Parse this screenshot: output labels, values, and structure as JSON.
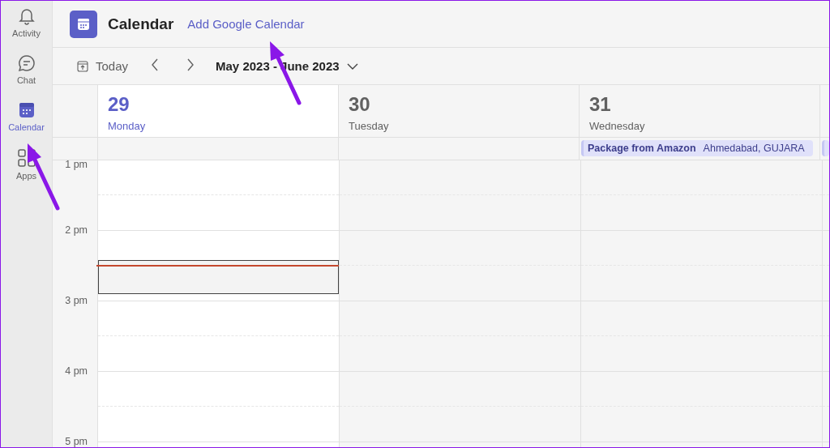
{
  "sidebar": {
    "items": [
      {
        "label": "Activity",
        "kind": "bell",
        "selected": false
      },
      {
        "label": "Chat",
        "kind": "chat",
        "selected": false
      },
      {
        "label": "Calendar",
        "kind": "calendar",
        "selected": true
      },
      {
        "label": "Apps",
        "kind": "apps",
        "selected": false
      }
    ]
  },
  "header": {
    "title": "Calendar",
    "link": "Add Google Calendar"
  },
  "toolbar": {
    "today": "Today",
    "range": "May 2023 - June 2023"
  },
  "days": [
    {
      "number": "29",
      "weekday": "Monday",
      "today": true
    },
    {
      "number": "30",
      "weekday": "Tuesday",
      "today": false
    },
    {
      "number": "31",
      "weekday": "Wednesday",
      "today": false,
      "all_day_events": [
        {
          "title": "Package from Amazon",
          "location": "Ahmedabad, GUJARA"
        }
      ]
    }
  ],
  "hours": [
    "1 pm",
    "2 pm",
    "3 pm",
    "4 pm",
    "5 pm"
  ]
}
